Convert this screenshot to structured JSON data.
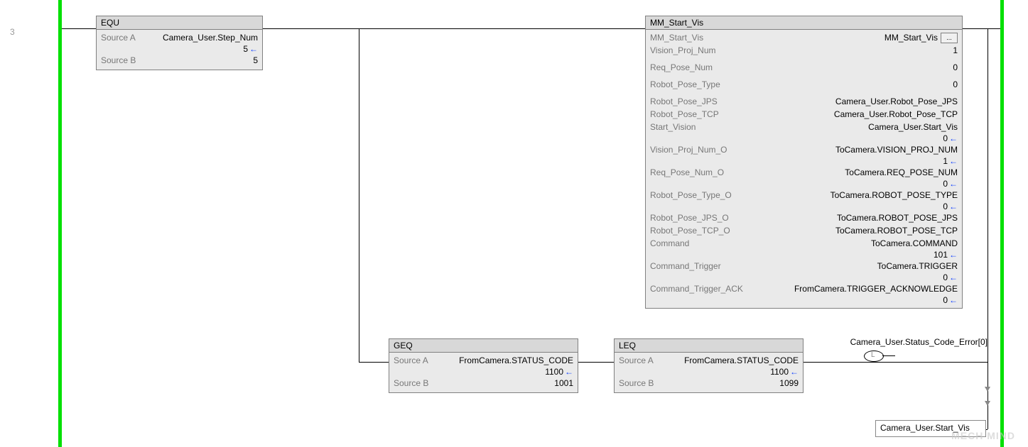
{
  "rung": "3",
  "equ": {
    "title": "EQU",
    "sourceA_label": "Source A",
    "sourceA_value": "Camera_User.Step_Num",
    "sourceA_live": "5",
    "sourceB_label": "Source B",
    "sourceB_value": "5"
  },
  "mm": {
    "title": "MM_Start_Vis",
    "ellipsis": "...",
    "rows": [
      {
        "label": "MM_Start_Vis",
        "value": "MM_Start_Vis",
        "btn": true
      },
      {
        "label": "Vision_Proj_Num",
        "value": "1"
      },
      {
        "label": "",
        "value": ""
      },
      {
        "label": "Req_Pose_Num",
        "value": "0"
      },
      {
        "label": "",
        "value": ""
      },
      {
        "label": "Robot_Pose_Type",
        "value": "0"
      },
      {
        "label": "",
        "value": ""
      },
      {
        "label": "Robot_Pose_JPS",
        "value": "Camera_User.Robot_Pose_JPS"
      },
      {
        "label": "Robot_Pose_TCP",
        "value": "Camera_User.Robot_Pose_TCP"
      },
      {
        "label": "Start_Vision",
        "value": "Camera_User.Start_Vis"
      },
      {
        "label": "",
        "value": "0",
        "arrow": true
      },
      {
        "label": "Vision_Proj_Num_O",
        "value": "ToCamera.VISION_PROJ_NUM"
      },
      {
        "label": "",
        "value": "1",
        "arrow": true
      },
      {
        "label": "Req_Pose_Num_O",
        "value": "ToCamera.REQ_POSE_NUM"
      },
      {
        "label": "",
        "value": "0",
        "arrow": true
      },
      {
        "label": "Robot_Pose_Type_O",
        "value": "ToCamera.ROBOT_POSE_TYPE"
      },
      {
        "label": "",
        "value": "0",
        "arrow": true
      },
      {
        "label": "Robot_Pose_JPS_O",
        "value": "ToCamera.ROBOT_POSE_JPS"
      },
      {
        "label": "Robot_Pose_TCP_O",
        "value": "ToCamera.ROBOT_POSE_TCP"
      },
      {
        "label": "Command",
        "value": "ToCamera.COMMAND"
      },
      {
        "label": "",
        "value": "101",
        "arrow": true
      },
      {
        "label": "Command_Trigger",
        "value": "ToCamera.TRIGGER"
      },
      {
        "label": "",
        "value": "0",
        "arrow": true
      },
      {
        "label": "Command_Trigger_ACK",
        "value": "FromCamera.TRIGGER_ACKNOWLEDGE"
      },
      {
        "label": "",
        "value": "0",
        "arrow": true
      }
    ]
  },
  "geq": {
    "title": "GEQ",
    "sourceA_label": "Source A",
    "sourceA_value": "FromCamera.STATUS_CODE",
    "sourceA_live": "1100",
    "sourceB_label": "Source B",
    "sourceB_value": "1001"
  },
  "leq": {
    "title": "LEQ",
    "sourceA_label": "Source A",
    "sourceA_value": "FromCamera.STATUS_CODE",
    "sourceA_live": "1100",
    "sourceB_label": "Source B",
    "sourceB_value": "1099"
  },
  "coil": {
    "label": "Camera_User.Status_Code_Error[0]",
    "letter": "L"
  },
  "branch_tag": "Camera_User.Start_Vis",
  "watermark": "MECH MIND"
}
